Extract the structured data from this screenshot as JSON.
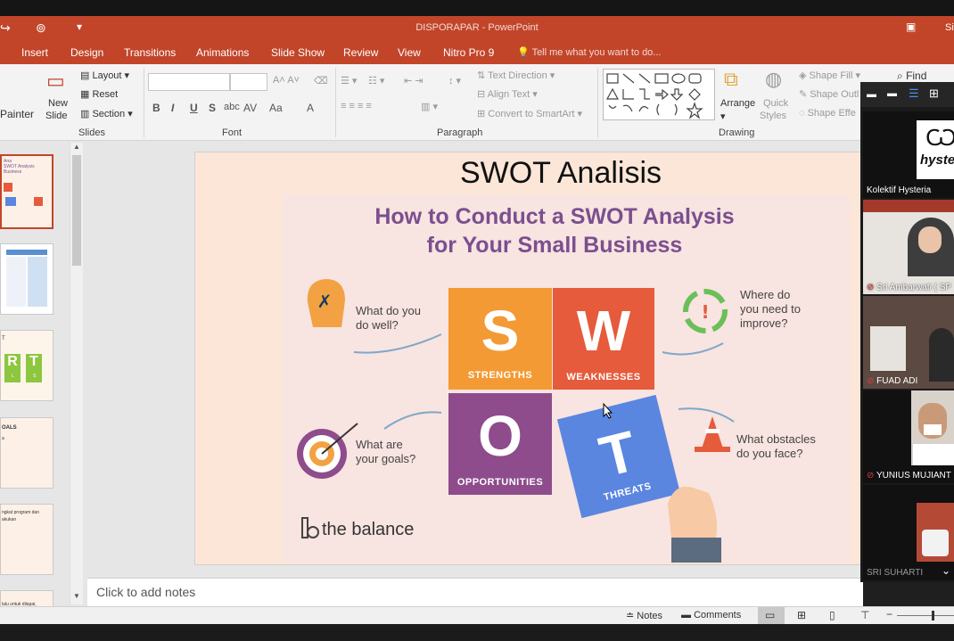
{
  "window": {
    "title": "DISPORAPAR - PowerPoint"
  },
  "tabs": [
    "Insert",
    "Design",
    "Transitions",
    "Animations",
    "Slide Show",
    "Review",
    "View",
    "Nitro Pro 9"
  ],
  "tell_me": "Tell me what you want to do...",
  "ribbon": {
    "format_painter": "Painter",
    "new_slide": [
      "New",
      "Slide"
    ],
    "layout": "Layout",
    "reset": "Reset",
    "section": "Section",
    "slides_group": "Slides",
    "font_group": "Font",
    "paragraph_group": "Paragraph",
    "drawing_group": "Drawing",
    "text_direction": "Text Direction",
    "align_text": "Align Text",
    "convert_smartart": "Convert to SmartArt",
    "arrange": "Arrange",
    "quick_styles": [
      "Quick",
      "Styles"
    ],
    "shape_fill": "Shape Fill",
    "shape_outline": "Shape Outl",
    "shape_effects": "Shape Effe",
    "find": "Find"
  },
  "thumbnails": {
    "t1": [
      "Ana",
      "SWOT Analysis",
      "Business"
    ],
    "t3": [
      "T",
      "R",
      "T",
      "L",
      "S"
    ],
    "t4": [
      "OALS",
      "a"
    ],
    "t5": [
      "ngkat program dan",
      "akukan"
    ],
    "t6": [
      "lalu untuk dilapai,"
    ]
  },
  "slide": {
    "title": "SWOT Analisis",
    "heading_1": "How to Conduct a SWOT Analysis",
    "heading_2": "for Your Small Business",
    "tiles": [
      {
        "letter": "S",
        "label": "STRENGTHS",
        "color": "#f39a34"
      },
      {
        "letter": "W",
        "label": "WEAKNESSES",
        "color": "#e55b3c"
      },
      {
        "letter": "O",
        "label": "OPPORTUNITIES",
        "color": "#8e4c8c"
      },
      {
        "letter": "T",
        "label": "THREATS",
        "color": "#5a86e0"
      }
    ],
    "questions": {
      "well": [
        "What do you",
        "do well?"
      ],
      "improve": [
        "Where do",
        "you need to",
        "improve?"
      ],
      "goals": [
        "What are",
        "your goals?"
      ],
      "obstacles": [
        "What obstacles",
        "do you face?"
      ]
    },
    "brand": "the balance"
  },
  "notes": {
    "placeholder": "Click to add notes"
  },
  "status": {
    "notes": "Notes",
    "comments": "Comments"
  },
  "video_panel": {
    "participants": [
      "Kolektif Hysteria",
      "Sri Ambarwati ( SP",
      "FUAD ADI",
      "YUNIUS MUJIANT",
      "SRI SUHARTI"
    ],
    "logo_text": "hyster"
  },
  "colors": {
    "accent": "#c2452a",
    "slide_bg": "#fbe6d8",
    "heading": "#7b4f8f"
  }
}
